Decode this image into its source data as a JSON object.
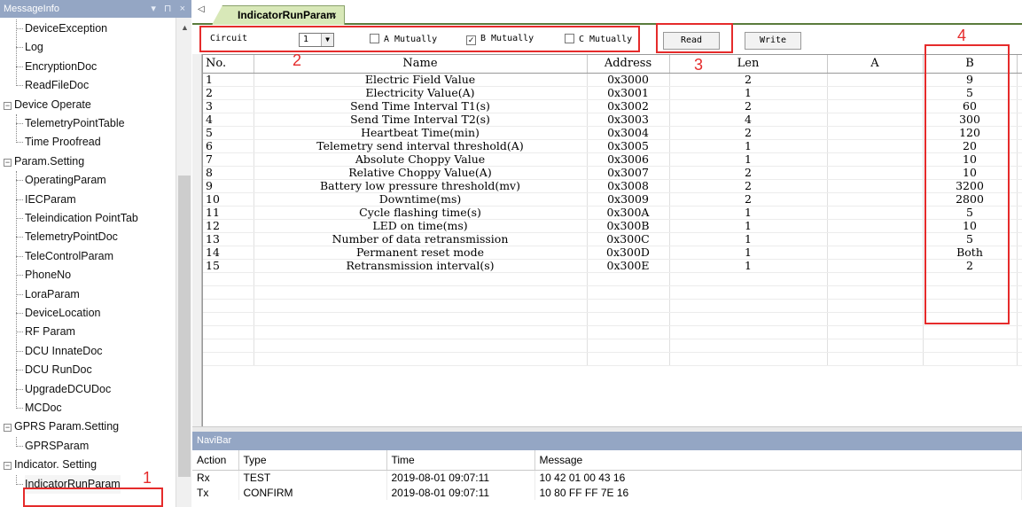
{
  "message_info": {
    "title": "MessageInfo",
    "controls": "▾ ⊓ ×",
    "tree": [
      {
        "label": "DeviceException",
        "type": "leaf"
      },
      {
        "label": "Log",
        "type": "leaf"
      },
      {
        "label": "EncryptionDoc",
        "type": "leaf"
      },
      {
        "label": "ReadFileDoc",
        "type": "leaf"
      },
      {
        "label": "Device Operate",
        "type": "root"
      },
      {
        "label": "TelemetryPointTable",
        "type": "leaf"
      },
      {
        "label": "Time Proofread",
        "type": "leaf"
      },
      {
        "label": "Param.Setting",
        "type": "root"
      },
      {
        "label": "OperatingParam",
        "type": "leaf"
      },
      {
        "label": "IECParam",
        "type": "leaf"
      },
      {
        "label": "Teleindication PointTab",
        "type": "leaf"
      },
      {
        "label": "TelemetryPointDoc",
        "type": "leaf"
      },
      {
        "label": "TeleControlParam",
        "type": "leaf"
      },
      {
        "label": "PhoneNo",
        "type": "leaf"
      },
      {
        "label": "LoraParam",
        "type": "leaf"
      },
      {
        "label": "DeviceLocation",
        "type": "leaf"
      },
      {
        "label": "RF Param",
        "type": "leaf"
      },
      {
        "label": "DCU InnateDoc",
        "type": "leaf"
      },
      {
        "label": "DCU RunDoc",
        "type": "leaf"
      },
      {
        "label": "UpgradeDCUDoc",
        "type": "leaf"
      },
      {
        "label": "MCDoc",
        "type": "leaf"
      },
      {
        "label": "GPRS Param.Setting",
        "type": "root"
      },
      {
        "label": "GPRSParam",
        "type": "leaf"
      },
      {
        "label": "Indicator. Setting",
        "type": "root"
      },
      {
        "label": "IndicatorRunParam",
        "type": "leaf"
      }
    ]
  },
  "document_tab": {
    "label": "IndicatorRunParam",
    "close": "×",
    "scroll": "◁"
  },
  "toolbar": {
    "circuit_label": "Circuit",
    "circuit_value": "1",
    "a_mutually": "A Mutually",
    "b_mutually": "B Mutually",
    "c_mutually": "C Mutually",
    "a_checked": false,
    "b_checked": true,
    "c_checked": false,
    "read_label": "Read",
    "write_label": "Write",
    "check_mark": "✓",
    "dropdown_glyph": "▼"
  },
  "annotations": {
    "n1": "1",
    "n2": "2",
    "n3": "3",
    "n4": "4",
    "color": "#e52b2b"
  },
  "grid": {
    "columns": [
      "No.",
      "Name",
      "Address",
      "Len",
      "A",
      "B"
    ],
    "rows": [
      {
        "no": "1",
        "name": "Electric Field Value",
        "address": "0x3000",
        "len": "2",
        "a": "",
        "b": "9"
      },
      {
        "no": "2",
        "name": "Electricity Value(A)",
        "address": "0x3001",
        "len": "1",
        "a": "",
        "b": "5"
      },
      {
        "no": "3",
        "name": "Send Time Interval T1(s)",
        "address": "0x3002",
        "len": "2",
        "a": "",
        "b": "60"
      },
      {
        "no": "4",
        "name": "Send Time Interval T2(s)",
        "address": "0x3003",
        "len": "4",
        "a": "",
        "b": "300"
      },
      {
        "no": "5",
        "name": "Heartbeat Time(min)",
        "address": "0x3004",
        "len": "2",
        "a": "",
        "b": "120"
      },
      {
        "no": "6",
        "name": "Telemetry send interval threshold(A)",
        "address": "0x3005",
        "len": "1",
        "a": "",
        "b": "20"
      },
      {
        "no": "7",
        "name": "Absolute Choppy Value",
        "address": "0x3006",
        "len": "1",
        "a": "",
        "b": "10"
      },
      {
        "no": "8",
        "name": "Relative Choppy Value(A)",
        "address": "0x3007",
        "len": "2",
        "a": "",
        "b": "10"
      },
      {
        "no": "9",
        "name": "Battery low pressure threshold(mv)",
        "address": "0x3008",
        "len": "2",
        "a": "",
        "b": "3200"
      },
      {
        "no": "10",
        "name": "Downtime(ms)",
        "address": "0x3009",
        "len": "2",
        "a": "",
        "b": "2800"
      },
      {
        "no": "11",
        "name": "Cycle flashing time(s)",
        "address": "0x300A",
        "len": "1",
        "a": "",
        "b": "5"
      },
      {
        "no": "12",
        "name": "LED on time(ms)",
        "address": "0x300B",
        "len": "1",
        "a": "",
        "b": "10"
      },
      {
        "no": "13",
        "name": "Number of data retransmission",
        "address": "0x300C",
        "len": "1",
        "a": "",
        "b": "5"
      },
      {
        "no": "14",
        "name": "Permanent reset mode",
        "address": "0x300D",
        "len": "1",
        "a": "",
        "b": "Both"
      },
      {
        "no": "15",
        "name": "Retransmission interval(s)",
        "address": "0x300E",
        "len": "1",
        "a": "",
        "b": "2"
      }
    ]
  },
  "navibar": {
    "title": "NaviBar",
    "columns": [
      "Action",
      "Type",
      "Time",
      "Message"
    ],
    "rows": [
      {
        "action": "Rx",
        "type": "TEST",
        "time": "2019-08-01 09:07:11",
        "message": "10 42 01 00 43 16"
      },
      {
        "action": "Tx",
        "type": "CONFIRM",
        "time": "2019-08-01 09:07:11",
        "message": "10 80 FF FF 7E 16"
      }
    ]
  }
}
